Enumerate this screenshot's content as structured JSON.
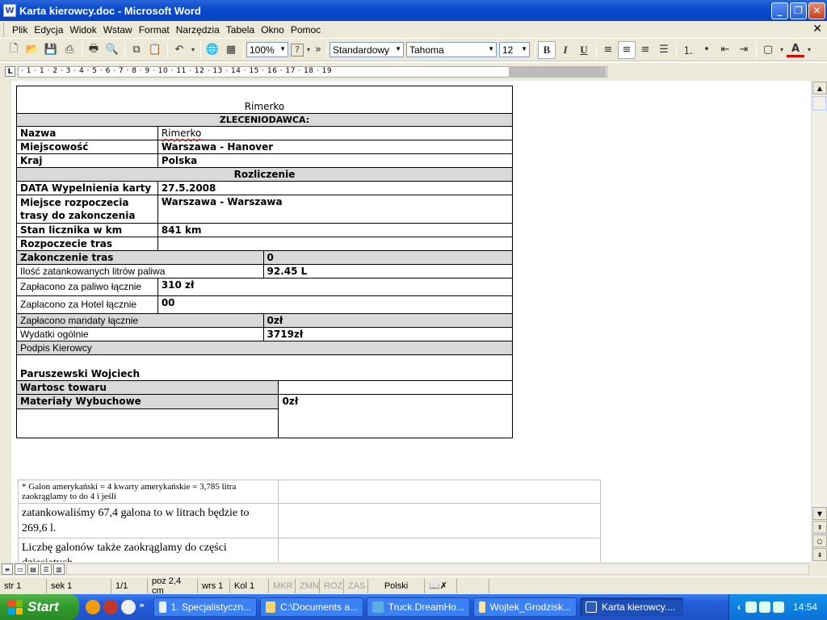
{
  "window": {
    "title": "Karta kierowcy.doc - Microsoft Word",
    "app_icon": "W",
    "controls": {
      "minimize": "_",
      "restore": "❐",
      "close": "✕"
    }
  },
  "menu": {
    "items": [
      "Plik",
      "Edycja",
      "Widok",
      "Wstaw",
      "Format",
      "Narzędzia",
      "Tabela",
      "Okno",
      "Pomoc"
    ],
    "close": "✕"
  },
  "toolbar": {
    "zoom": "100%",
    "style": "Standardowy",
    "font": "Tahoma",
    "size": "12",
    "bold": "B",
    "italic": "I",
    "underline": "U",
    "font_color_label": "A",
    "more": "»"
  },
  "ruler": {
    "tab_selector": "L",
    "numbers": "· 1 · 1 · 2 · 3 · 4 · 5 · 6 · 7 · 8 · 9 · 10 · 11 · 12 · 13 · 14 · 15 · 16 · 17 · 18 · 19"
  },
  "document": {
    "title": "Rimerko",
    "client_header": "ZLECENIODAWCA:",
    "nazwa_label": "Nazwa",
    "nazwa_value": "Rimerko",
    "miejscowosc_label": "Miejscowość",
    "miejscowosc_value": "Warszawa - Hanover",
    "kraj_label": "Kraj",
    "kraj_value": "Polska",
    "rozliczenie_header": "Rozliczenie",
    "data_label": "DATA Wypelnienia karty",
    "data_value": "27.5.2008",
    "miejsce_label": "Miejsce rozpoczecia trasy do zakonczenia",
    "miejsce_value": "Warszawa - Warszawa",
    "stan_label": "Stan licznika w km",
    "stan_value": "841 km",
    "rozpoczecie_label": "Rozpoczecie tras",
    "zakonczenie_label": "Zakonczenie tras",
    "zakonczenie_value": "0",
    "ilosc_label": "Ilość zatankowanych litrów paliwa",
    "ilosc_value": "92.45 L",
    "paliwo_label": "Zapłacono za paliwo łącznie",
    "paliwo_value": "310 zł",
    "hotel_label": " Zaplacono za Hotel łącznie",
    "hotel_value": "00",
    "mandaty_label": "Zapłacono mandaty łącznie",
    "mandaty_value": "0zł",
    "wydatki_label": "Wydatki ogólnie",
    "wydatki_value": "3719zł",
    "podpis_label": "Podpis Kierowcy",
    "podpis_value": "Paruszewski Wojciech",
    "wartosc_label": "Wartosc towaru",
    "materialy_label": "Materiały Wybuchowe",
    "materialy_value": "0zł"
  },
  "notes": {
    "row1": "* Galon amerykański = 4 kwarty amerykańskie = 3,785 litra zaokrąglamy to do 4 i jeśli",
    "row2": "zatankowaliśmy 67,4 galona to w litrach będzie to 269,6 l.",
    "row3": "Liczbę galonów także zaokrąglamy do części dziesiątych"
  },
  "status": {
    "page": "str 1",
    "section": "sek 1",
    "pages": "1/1",
    "position": "poz 2,4 cm",
    "line": "wrs 1",
    "column": "Kol 1",
    "mode_rec": "MKR",
    "mode_trk": "ZMN",
    "mode_ext": "ROZ",
    "mode_ovr": "ZAS",
    "language": "Polski"
  },
  "taskbar": {
    "start": "Start",
    "more": "»",
    "tasks": [
      "1. Specjalistyczn...",
      "C:\\Documents a...",
      "Truck.DreamHo...",
      "Wojtek_Grodzisk...",
      "Karta kierowcy...."
    ],
    "tray_arrow": "‹",
    "time": "14:54"
  }
}
